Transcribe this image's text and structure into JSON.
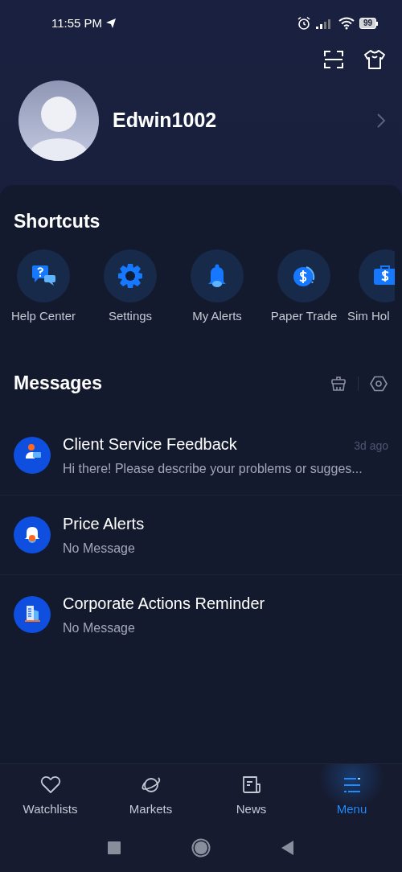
{
  "status_bar": {
    "time": "11:55 PM",
    "battery": "99"
  },
  "profile": {
    "username": "Edwin1002"
  },
  "shortcuts": {
    "title": "Shortcuts",
    "items": [
      {
        "label": "Help Center"
      },
      {
        "label": "Settings"
      },
      {
        "label": "My Alerts"
      },
      {
        "label": "Paper Trade"
      },
      {
        "label": "Sim Hol"
      }
    ]
  },
  "messages": {
    "title": "Messages",
    "items": [
      {
        "title": "Client Service Feedback",
        "preview": "Hi there! Please describe your problems or sugges...",
        "time": "3d ago"
      },
      {
        "title": "Price Alerts",
        "preview": "No Message"
      },
      {
        "title": "Corporate Actions Reminder",
        "preview": "No Message"
      }
    ]
  },
  "bottom_nav": [
    {
      "label": "Watchlists",
      "selected": false
    },
    {
      "label": "Markets",
      "selected": false
    },
    {
      "label": "News",
      "selected": false
    },
    {
      "label": "Menu",
      "selected": true
    }
  ]
}
